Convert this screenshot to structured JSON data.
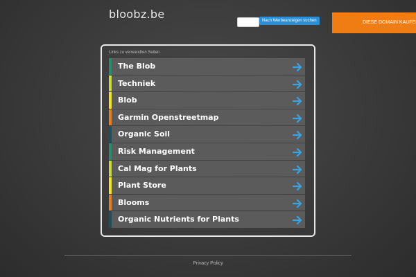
{
  "header": {
    "domain": "bloobz.be",
    "search_placeholder": "",
    "search_button_label": "Nach Werbeanzeigen suchen",
    "buy_banner_label": "DIESE DOMAIN KAUFEN"
  },
  "panel": {
    "heading": "Links zu verwandten Seiten",
    "links": [
      {
        "label": "The Blob",
        "accent": "#2a8c6e"
      },
      {
        "label": "Techniek",
        "accent": "#c9d944"
      },
      {
        "label": "Blob",
        "accent": "#f2e232"
      },
      {
        "label": "Garmin Openstreetmap",
        "accent": "#e67e22"
      },
      {
        "label": "Organic Soil",
        "accent": "#1f4f5f"
      },
      {
        "label": "Risk Management",
        "accent": "#2a8c6e"
      },
      {
        "label": "Cal Mag for Plants",
        "accent": "#c9d944"
      },
      {
        "label": "Plant Store",
        "accent": "#f2e232"
      },
      {
        "label": "Blooms",
        "accent": "#e67e22"
      },
      {
        "label": "Organic Nutrients for Plants",
        "accent": "#1f4f5f"
      }
    ],
    "arrow_icon": "arrow-right-icon",
    "arrow_color": "#3aa3e3"
  },
  "footer": {
    "privacy_label": "Privacy Policy"
  }
}
